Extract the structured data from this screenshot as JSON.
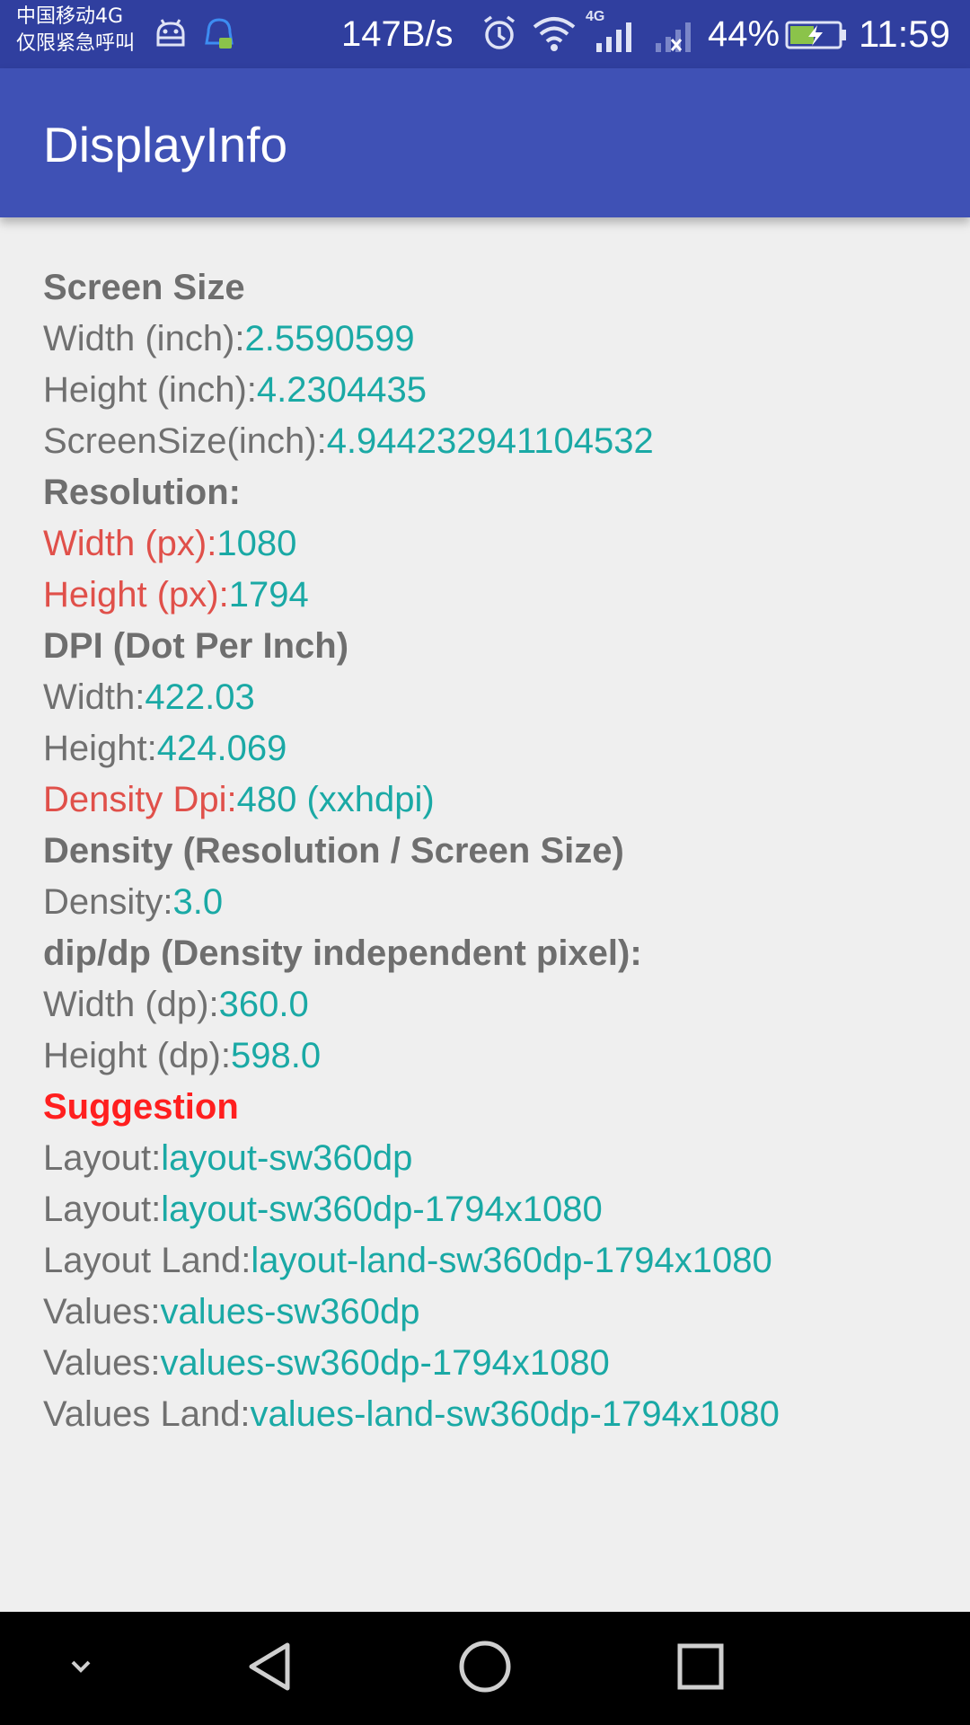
{
  "status_bar": {
    "carrier_line1": "中国移动4G",
    "carrier_line2": "仅限紧急呼叫",
    "net_speed": "147B/s",
    "signal_label": "4G",
    "battery_percent": "44%",
    "time": "11:59",
    "icons": [
      "android-debug-icon",
      "notification-app-icon",
      "alarm-icon",
      "wifi-icon",
      "signal-icon",
      "no-signal-icon",
      "battery-icon"
    ]
  },
  "app_bar": {
    "title": "DisplayInfo"
  },
  "colors": {
    "status_bar": "#303f9f",
    "app_bar": "#3f51b5",
    "background": "#efefef",
    "label_gray": "#707070",
    "label_red": "#e0504a",
    "value_teal": "#1aa9a5",
    "suggestion_red": "#ff1f1f"
  },
  "content": {
    "screen_size_heading": "Screen Size",
    "width_inch_label": "Width (inch):",
    "width_inch_value": "2.5590599",
    "height_inch_label": "Height (inch):",
    "height_inch_value": "4.2304435",
    "screensize_label": "ScreenSize(inch):",
    "screensize_value": "4.944232941104532",
    "resolution_heading": "Resolution:",
    "width_px_label": "Width (px):",
    "width_px_value": "1080",
    "height_px_label": "Height (px):",
    "height_px_value": "1794",
    "dpi_heading": "DPI (Dot Per Inch)",
    "dpi_width_label": "Width:",
    "dpi_width_value": "422.03",
    "dpi_height_label": "Height:",
    "dpi_height_value": "424.069",
    "density_dpi_label": "Density Dpi:",
    "density_dpi_value": "480 (xxhdpi)",
    "density_heading": "Density (Resolution / Screen Size)",
    "density_label": "Density:",
    "density_value": "3.0",
    "dp_heading": "dip/dp (Density independent pixel):",
    "width_dp_label": "Width (dp):",
    "width_dp_value": "360.0",
    "height_dp_label": "Height (dp):",
    "height_dp_value": "598.0",
    "suggestion_heading": "Suggestion",
    "layout1_label": "Layout:",
    "layout1_value": "layout-sw360dp",
    "layout2_label": "Layout:",
    "layout2_value": "layout-sw360dp-1794x1080",
    "layout_land_label": "Layout Land:",
    "layout_land_value": "layout-land-sw360dp-1794x1080",
    "values1_label": "Values:",
    "values1_value": "values-sw360dp",
    "values2_label": "Values:",
    "values2_value": "values-sw360dp-1794x1080",
    "values_land_label": "Values Land:",
    "values_land_value": "values-land-sw360dp-1794x1080"
  },
  "nav_bar": {
    "icons": [
      "hide-nav-chevron-icon",
      "back-triangle-icon",
      "home-circle-icon",
      "recents-square-icon"
    ]
  }
}
